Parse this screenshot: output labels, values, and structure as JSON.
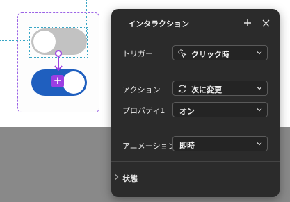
{
  "panel": {
    "title": "インタラクション",
    "rows": {
      "trigger": {
        "label": "トリガー",
        "value": "クリック時",
        "icon": "click-sparkle-icon"
      },
      "action": {
        "label": "アクション",
        "value": "次に変更",
        "icon": "refresh-icon"
      },
      "property": {
        "label": "プロパティ1",
        "value": "オン"
      },
      "animation": {
        "label": "アニメーション",
        "value": "即時"
      }
    },
    "state_section": {
      "label": "状態"
    }
  },
  "colors": {
    "panel_bg": "#2b2b2b",
    "toggle_on": "#1f5fbf",
    "toggle_off": "#c2c2c2",
    "selection": "#9b63e6",
    "badge": "#9c3fe3"
  }
}
